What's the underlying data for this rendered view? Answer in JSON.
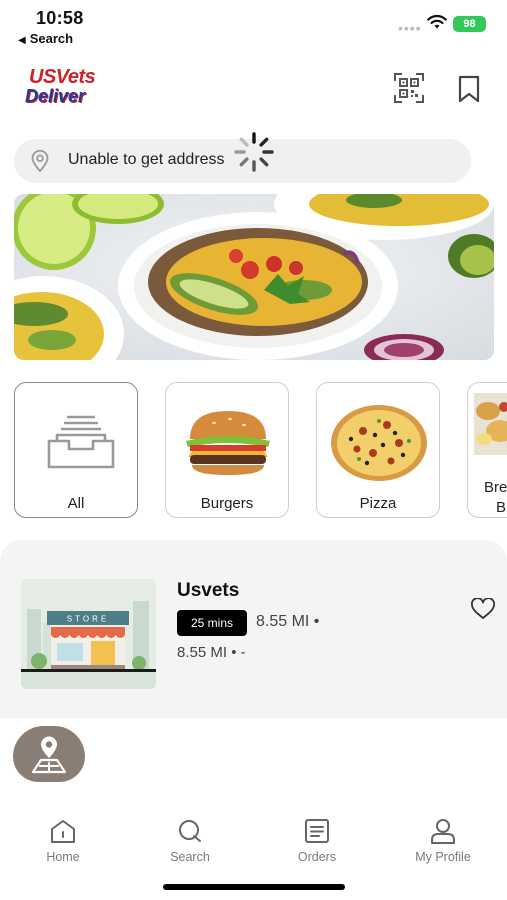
{
  "status_bar": {
    "time": "10:58",
    "back_label": "Search",
    "battery": "98"
  },
  "header": {
    "logo_line1": "USVets",
    "logo_line2": "Deliver",
    "qr_icon": "qr-scan-icon",
    "bookmark_icon": "bookmark-icon"
  },
  "address": {
    "text": "Unable to get address",
    "icon": "location-pin-icon"
  },
  "categories": [
    {
      "label": "All",
      "icon": "tray-icon"
    },
    {
      "label": "Burgers",
      "icon": "burger-image"
    },
    {
      "label": "Pizza",
      "icon": "pizza-image"
    },
    {
      "label": "Bre",
      "label2": "B",
      "icon": "breakfast-image"
    }
  ],
  "store": {
    "name": "Usvets",
    "time_badge": "25 mins",
    "distance1": "8.55 MI •",
    "distance2": "8.55 MI • -",
    "favorite_icon": "heart-icon"
  },
  "nav": [
    {
      "label": "Home",
      "icon": "home-icon"
    },
    {
      "label": "Search",
      "icon": "search-icon"
    },
    {
      "label": "Orders",
      "icon": "orders-icon"
    },
    {
      "label": "My Profile",
      "icon": "profile-icon"
    }
  ],
  "colors": {
    "badge_bg": "#000000",
    "nav_label": "#7a7a7a",
    "battery": "#34c759",
    "fab": "#8a7e74",
    "logo_red": "#d21f26",
    "logo_blue": "#1c3c9c"
  }
}
